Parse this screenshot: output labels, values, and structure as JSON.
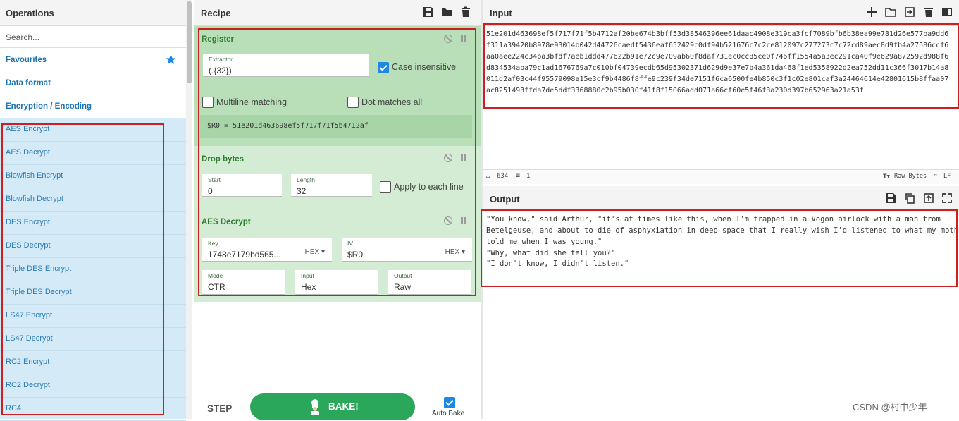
{
  "operations": {
    "title": "Operations",
    "search_placeholder": "Search...",
    "categories": [
      "Favourites",
      "Data format",
      "Encryption / Encoding"
    ],
    "items": [
      "AES Encrypt",
      "AES Decrypt",
      "Blowfish Encrypt",
      "Blowfish Decrypt",
      "DES Encrypt",
      "DES Decrypt",
      "Triple DES Encrypt",
      "Triple DES Decrypt",
      "LS47 Encrypt",
      "LS47 Decrypt",
      "RC2 Encrypt",
      "RC2 Decrypt",
      "RC4"
    ]
  },
  "recipe": {
    "title": "Recipe",
    "register": {
      "name": "Register",
      "extractor_label": "Extractor",
      "extractor_value": "(.{32})",
      "case_insensitive_label": "Case insensitive",
      "case_insensitive": true,
      "multiline_label": "Multiline matching",
      "dot_matches_all_label": "Dot matches all",
      "result": "$R0 = 51e201d463698ef5f717f71f5b4712af"
    },
    "drop_bytes": {
      "name": "Drop bytes",
      "start_label": "Start",
      "start_value": "0",
      "length_label": "Length",
      "length_value": "32",
      "apply_each_label": "Apply to each line"
    },
    "aes_decrypt": {
      "name": "AES Decrypt",
      "key_label": "Key",
      "key_value": "1748e7179bd565...",
      "key_format": "HEX",
      "iv_label": "IV",
      "iv_value": "$R0",
      "iv_format": "HEX",
      "mode_label": "Mode",
      "mode_value": "CTR",
      "input_label": "Input",
      "input_value": "Hex",
      "output_label": "Output",
      "output_value": "Raw"
    },
    "step_label": "STEP",
    "bake_label": "BAKE!",
    "auto_bake_label": "Auto Bake",
    "auto_bake": true
  },
  "input": {
    "title": "Input",
    "lines": [
      "51e201d463698ef5f717f71f5b4712af20be674b3bff53d38546396ee61daac4908e319ca3fcf7089bfb6b38ea99e781d26e577ba9dd6",
      "f311a39420b8978e93014b042d44726caedf5436eaf652429c0df94b521676c7c2ce812097c277273c7c72cd89aec8d9fb4a27586ccf6",
      "aa0aee224c34ba3bfdf7aeb1ddd477622b91e72c9e709ab60f8daf731ec0cc85ce0f746ff1554a5a3ec291ca40f9e629a872592d988f6",
      "d834534aba79c1ad1676769a7c010bf04739ecdb65d95302371d629d9e37e7b4a361da468f1ed5358922d2ea752dd11c366f3017b14a8",
      "011d2af03c44f95579098a15e3cf9b4486f8ffe9c239f34de7151f6ca6500fe4b850c3f1c02e801caf3a24464614e42801615b8ffaa07",
      "ac8251493ffda7de5ddf3368880c2b95b030f41f8f15066add071a66cf60e5f46f3a230d397b652963a21a53f"
    ],
    "length": "634",
    "lines_count": "1",
    "raw_bytes_label": "Raw Bytes",
    "eol_label": "LF"
  },
  "output": {
    "title": "Output",
    "lines": [
      "\"You know,\" said Arthur, \"it's at times like this, when I'm trapped in a Vogon airlock with a man from",
      "Betelgeuse, and about to die of asphyxiation in deep space that I really wish I'd listened to what my mother",
      "told me when I was young.\"",
      "\"Why, what did she tell you?\"",
      "\"I don't know, I didn't listen.\""
    ]
  },
  "watermark": "CSDN @村中少年",
  "colors": {
    "accent": "#1e88e5",
    "recipe_bg": "#c8e7c8",
    "ops_bg": "#d4ebf7",
    "highlight_box": "#cc1f1f",
    "bake": "#2aa75a"
  }
}
